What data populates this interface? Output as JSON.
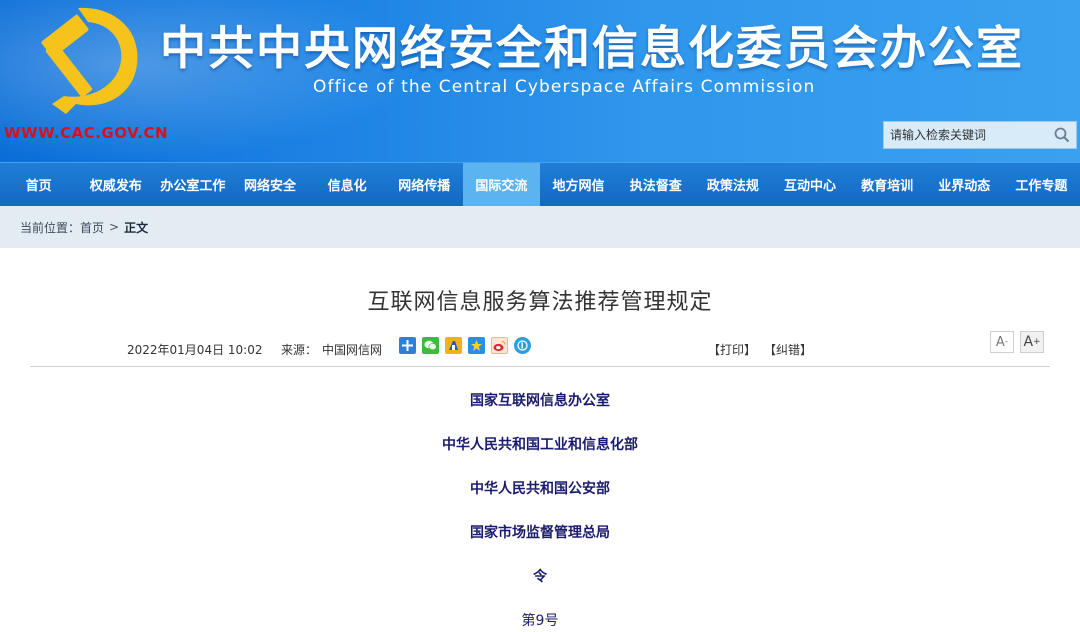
{
  "header": {
    "title": "中共中央网络安全和信息化委员会办公室",
    "subtitle": "Office of the Central Cyberspace Affairs Commission",
    "domain": "WWW.CAC.GOV.CN",
    "emblem_icon": "party-emblem-icon",
    "search": {
      "placeholder": "请输入检索关键词",
      "icon": "search-icon"
    }
  },
  "nav": {
    "items": [
      {
        "label": "首页"
      },
      {
        "label": "权威发布"
      },
      {
        "label": "办公室工作"
      },
      {
        "label": "网络安全"
      },
      {
        "label": "信息化"
      },
      {
        "label": "网络传播"
      },
      {
        "label": "国际交流"
      },
      {
        "label": "地方网信"
      },
      {
        "label": "执法督查"
      },
      {
        "label": "政策法规"
      },
      {
        "label": "互动中心"
      },
      {
        "label": "教育培训"
      },
      {
        "label": "业界动态"
      },
      {
        "label": "工作专题"
      }
    ],
    "active": "国际交流"
  },
  "breadcrumb": {
    "label": "当前位置：",
    "home": "首页",
    "separator": ">",
    "current": "正文"
  },
  "article": {
    "title": "互联网信息服务算法推荐管理规定",
    "date": "2022年01月04日 10:02",
    "source_label": "来源：",
    "source": "中国网信网",
    "print": "【打印】",
    "correct": "【纠错】",
    "font_decrease": "A",
    "font_increase": "A",
    "share_icons": [
      "plus-share-icon",
      "wechat-icon",
      "sina-icon",
      "qzone-icon",
      "weibo-icon",
      "pdf-icon"
    ],
    "lines": [
      "国家互联网信息办公室",
      "中华人民共和国工业和信息化部",
      "中华人民共和国公安部",
      "国家市场监督管理总局",
      "令",
      "第9号"
    ]
  },
  "colors": {
    "header_blue": "#1f86e6",
    "nav_blue": "#1468c2",
    "nav_active": "#5bb4f0",
    "domain_red": "#d8121c",
    "emblem_yellow": "#f6c31c",
    "issuer_text": "#1b1b6e"
  }
}
